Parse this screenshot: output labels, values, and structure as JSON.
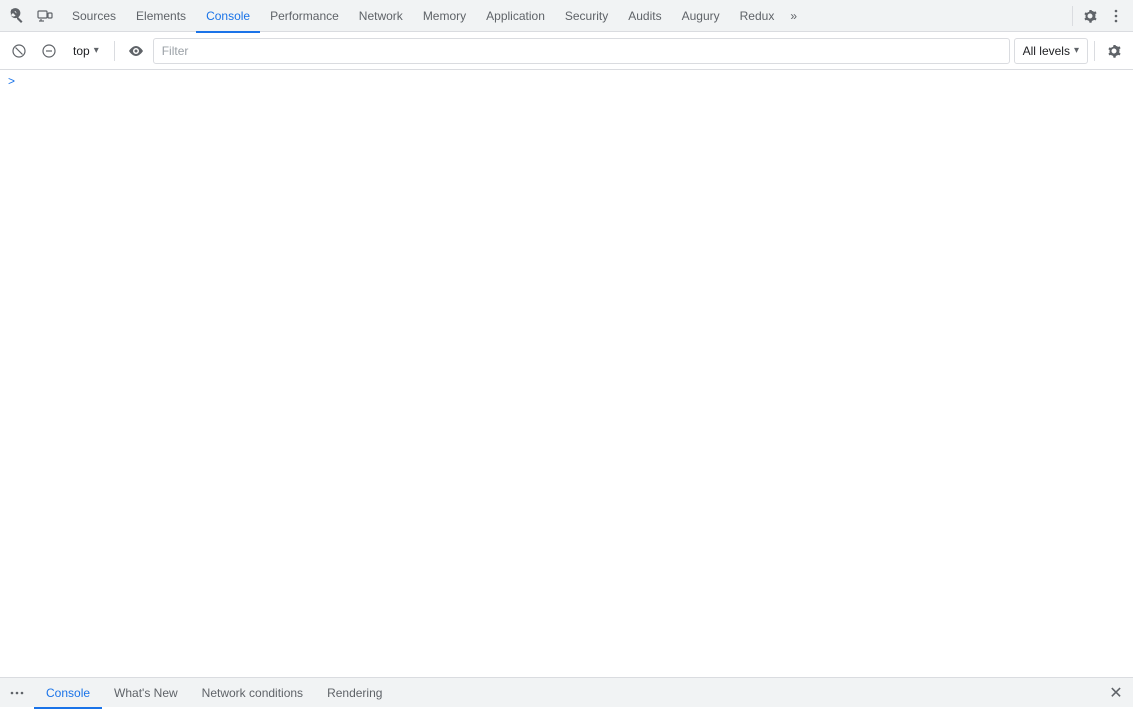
{
  "tabs": {
    "items": [
      {
        "id": "sources",
        "label": "Sources",
        "active": false
      },
      {
        "id": "elements",
        "label": "Elements",
        "active": false
      },
      {
        "id": "console",
        "label": "Console",
        "active": true
      },
      {
        "id": "performance",
        "label": "Performance",
        "active": false
      },
      {
        "id": "network",
        "label": "Network",
        "active": false
      },
      {
        "id": "memory",
        "label": "Memory",
        "active": false
      },
      {
        "id": "application",
        "label": "Application",
        "active": false
      },
      {
        "id": "security",
        "label": "Security",
        "active": false
      },
      {
        "id": "audits",
        "label": "Audits",
        "active": false
      },
      {
        "id": "augury",
        "label": "Augury",
        "active": false
      },
      {
        "id": "redux",
        "label": "Redux",
        "active": false
      }
    ],
    "more_icon": "»"
  },
  "toolbar": {
    "context": "top",
    "context_arrow": "▾",
    "filter_placeholder": "Filter",
    "levels_label": "All levels",
    "levels_arrow": "▾"
  },
  "console": {
    "prompt_symbol": ">"
  },
  "bottom_tabs": {
    "items": [
      {
        "id": "console-bottom",
        "label": "Console",
        "active": true
      },
      {
        "id": "whats-new",
        "label": "What's New",
        "active": false
      },
      {
        "id": "network-conditions",
        "label": "Network conditions",
        "active": false
      },
      {
        "id": "rendering",
        "label": "Rendering",
        "active": false
      }
    ]
  },
  "icons": {
    "inspect": "⬚",
    "device": "▭",
    "clear": "🚫",
    "eye": "👁",
    "settings": "⚙",
    "more_vert": "⋮",
    "menu": "⋮",
    "close": "✕"
  }
}
